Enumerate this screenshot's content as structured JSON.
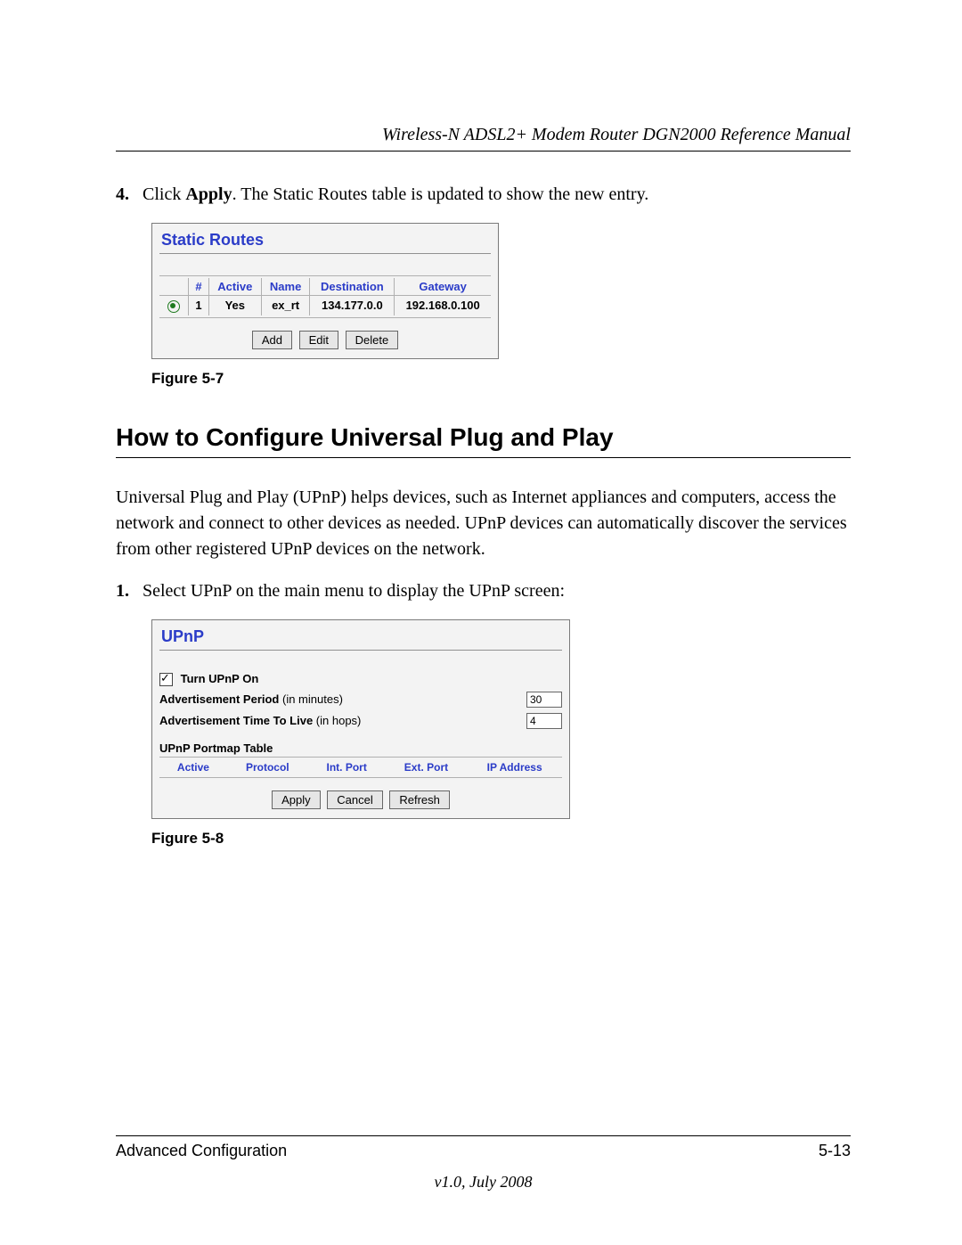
{
  "header": {
    "title": "Wireless-N ADSL2+ Modem Router DGN2000 Reference Manual"
  },
  "step4": {
    "num": "4.",
    "text_before": "Click ",
    "apply_word": "Apply",
    "text_after": ". The Static Routes table is updated to show the new entry."
  },
  "static_routes_panel": {
    "title": "Static Routes",
    "headers": {
      "num": "#",
      "active": "Active",
      "name": "Name",
      "destination": "Destination",
      "gateway": "Gateway"
    },
    "row": {
      "num": "1",
      "active": "Yes",
      "name": "ex_rt",
      "destination": "134.177.0.0",
      "gateway": "192.168.0.100"
    },
    "buttons": {
      "add": "Add",
      "edit": "Edit",
      "delete": "Delete"
    }
  },
  "fig7_caption": "Figure 5-7",
  "heading_upnp": "How to Configure Universal Plug and Play",
  "upnp_intro": "Universal Plug and Play (UPnP) helps devices, such as Internet appliances and computers, access the network and connect to other devices as needed. UPnP devices can automatically discover the services from other registered UPnP devices on the network.",
  "step1": {
    "num": "1.",
    "text": "Select UPnP on the main menu to display the UPnP screen:"
  },
  "upnp_panel": {
    "title": "UPnP",
    "turn_on": "Turn UPnP On",
    "adv_period_label": "Advertisement Period ",
    "adv_period_sub": "(in minutes)",
    "adv_period_value": "30",
    "ttl_label": "Advertisement Time To Live ",
    "ttl_sub": "(in hops)",
    "ttl_value": "4",
    "portmap_heading": "UPnP Portmap Table",
    "portmap_headers": {
      "active": "Active",
      "protocol": "Protocol",
      "int_port": "Int. Port",
      "ext_port": "Ext. Port",
      "ip": "IP Address"
    },
    "buttons": {
      "apply": "Apply",
      "cancel": "Cancel",
      "refresh": "Refresh"
    }
  },
  "fig8_caption": "Figure 5-8",
  "footer": {
    "section": "Advanced Configuration",
    "page": "5-13",
    "version": "v1.0, July 2008"
  }
}
